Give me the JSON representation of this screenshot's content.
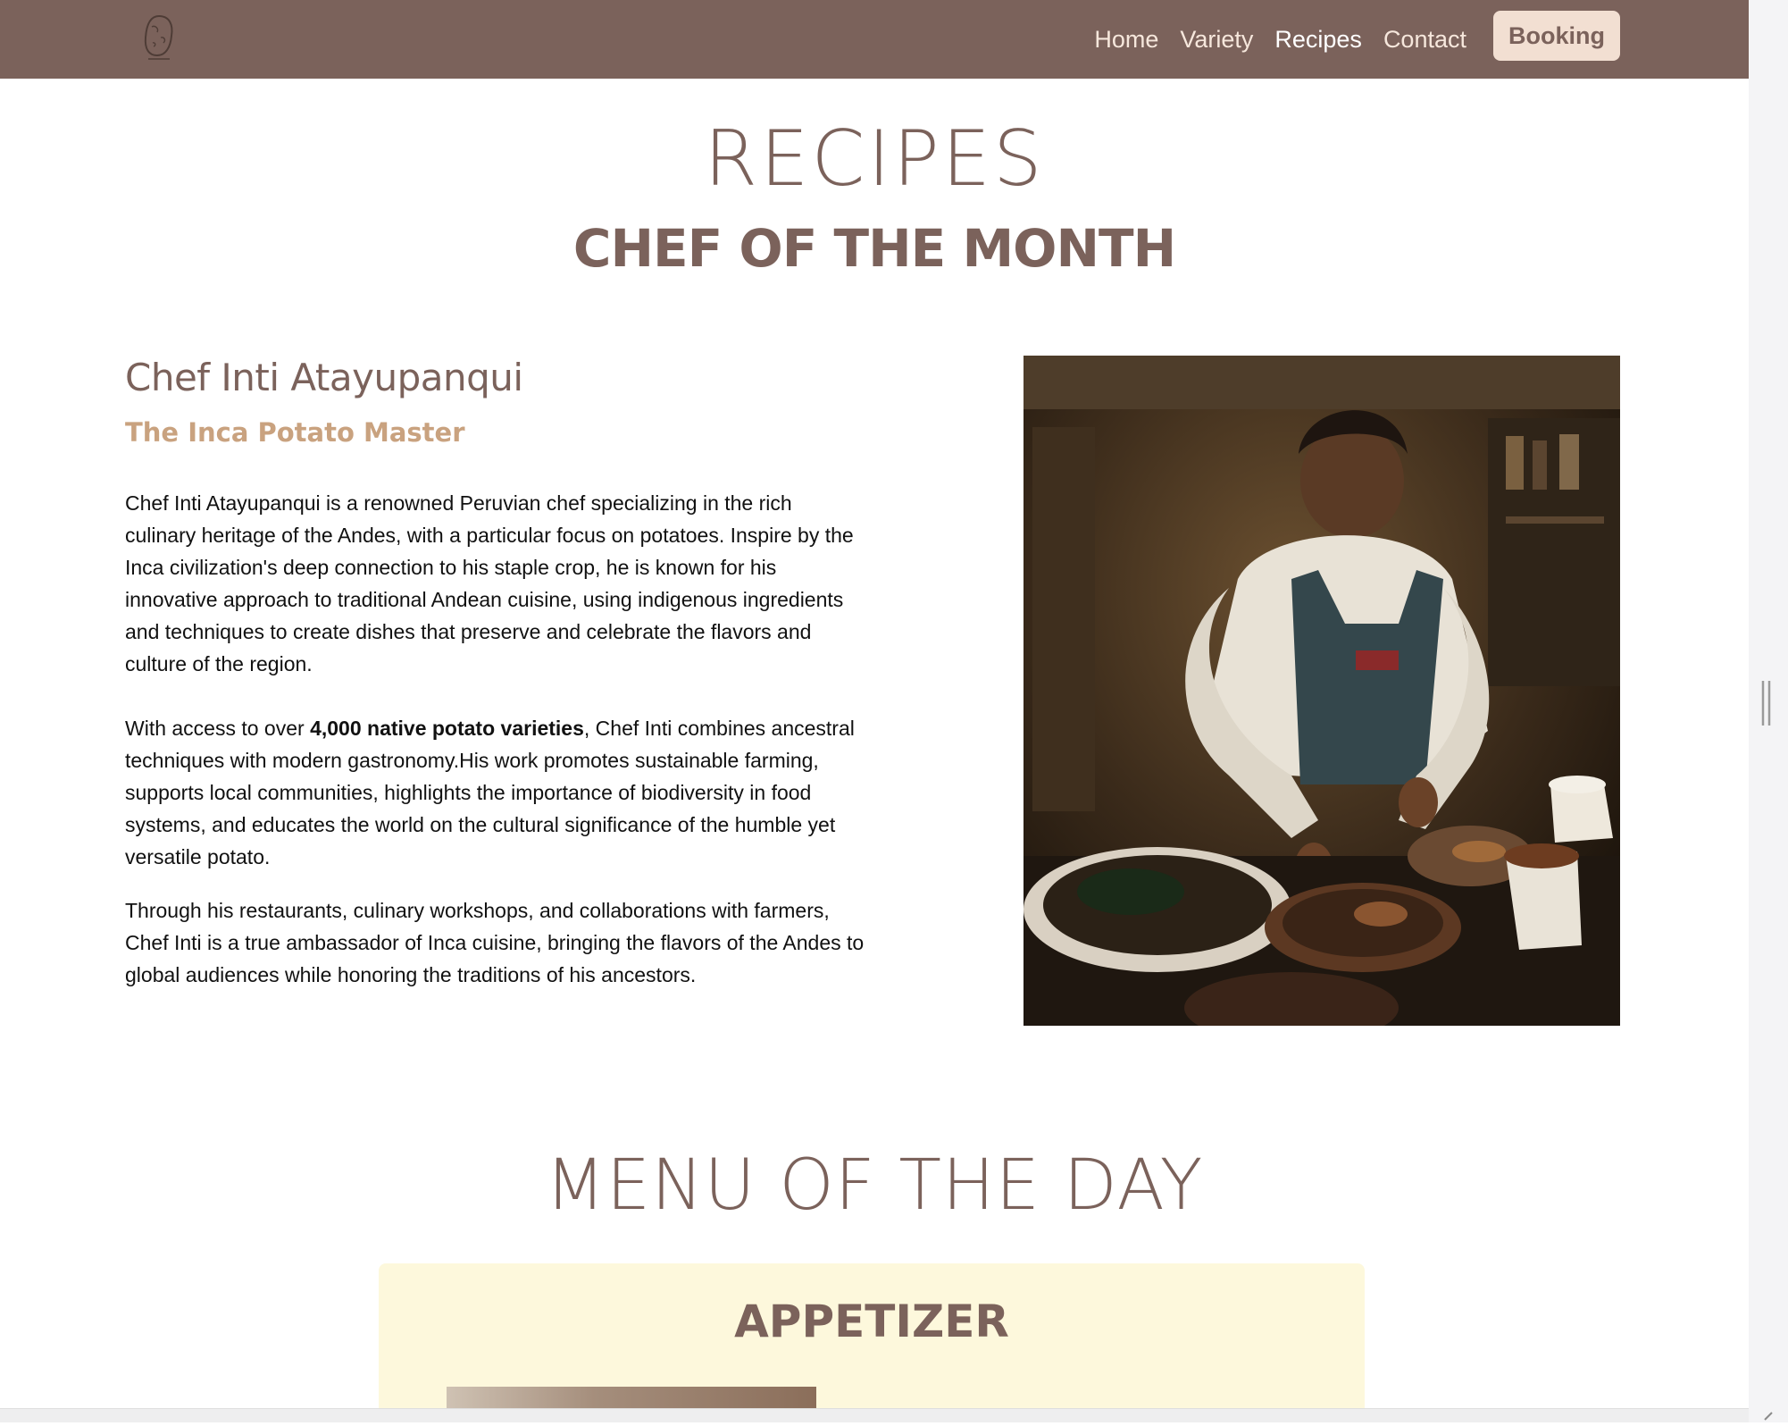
{
  "nav": {
    "logo_icon": "potato-logo-icon",
    "links": [
      "Home",
      "Variety",
      "Recipes",
      "Contact"
    ],
    "active": "Recipes",
    "booking_label": "Booking"
  },
  "headings": {
    "recipes": "RECIPES",
    "chef_of_month": "CHEF OF THE MONTH"
  },
  "chef": {
    "name": "Chef Inti Atayupanqui",
    "tagline": "The Inca Potato Master",
    "paragraph1": "Chef Inti Atayupanqui is a renowned Peruvian chef specializing in the rich culinary heritage of the Andes, with a particular focus on potatoes. Inspire by the Inca civilization's deep connection to his staple crop, he is known for his innovative approach to traditional Andean cuisine, using indigenous ingredients and techniques to create dishes that preserve and celebrate the flavors and culture of the region.",
    "paragraph2_pre": "With access to over ",
    "paragraph2_bold": "4,000 native potato varieties",
    "paragraph2_post": ", Chef Inti combines ancestral techniques with modern gastronomy.His work promotes sustainable farming, supports local communities, highlights the importance of biodiversity in food systems, and educates the world on the cultural significance of the humble yet versatile potato.",
    "paragraph3": "Through his restaurants, culinary workshops, and collaborations with farmers, Chef Inti is a true ambassador of Inca cuisine, bringing the flavors of the Andes to global audiences while honoring the traditions of his ancestors."
  },
  "menu": {
    "title": "MENU OF THE DAY",
    "course": "APPETIZER"
  },
  "colors": {
    "brand": "#7b625b",
    "accent": "#c9a27f",
    "booking_bg": "#f2dfd2",
    "card_bg": "#fdf8dc"
  }
}
